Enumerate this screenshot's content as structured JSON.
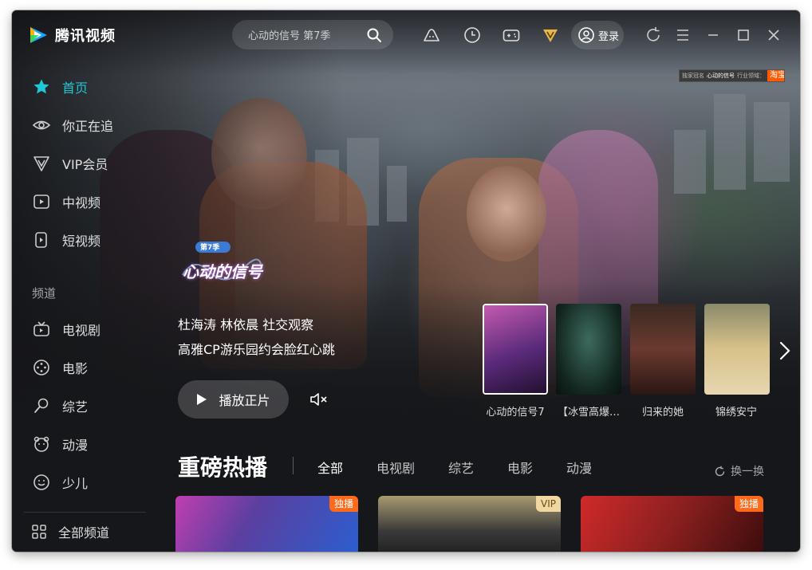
{
  "app": {
    "name": "腾讯视频",
    "colors": {
      "accent": "#1ec8d6",
      "vip_gold": "#e8b84a",
      "badge_orange": "#ff6a1a"
    }
  },
  "search": {
    "placeholder": "心动的信号 第7季",
    "icon": "search-icon"
  },
  "toolbar": {
    "icons": [
      "cloud-game-icon",
      "history-icon",
      "gamepad-icon",
      "vip-diamond-icon"
    ],
    "login_label": "登录",
    "window_controls": [
      "refresh-icon",
      "menu-icon",
      "minimize-icon",
      "maximize-icon",
      "close-icon"
    ]
  },
  "ad": {
    "left_text": "独家冠名",
    "brand": "心动的信号",
    "mid_text": "行业领域：",
    "right_text": "淘宝"
  },
  "sidebar": {
    "primary": [
      {
        "label": "首页",
        "icon": "star-icon",
        "active": true
      },
      {
        "label": "你正在追",
        "icon": "eye-icon"
      },
      {
        "label": "VIP会员",
        "icon": "vip-icon"
      },
      {
        "label": "中视频",
        "icon": "video-icon"
      },
      {
        "label": "短视频",
        "icon": "short-video-icon"
      }
    ],
    "channel_title": "频道",
    "channels": [
      {
        "label": "电视剧",
        "icon": "tv-icon"
      },
      {
        "label": "电影",
        "icon": "film-reel-icon"
      },
      {
        "label": "综艺",
        "icon": "microphone-icon"
      },
      {
        "label": "动漫",
        "icon": "bear-icon"
      },
      {
        "label": "少儿",
        "icon": "kids-icon"
      }
    ],
    "all_channels": {
      "label": "全部频道",
      "icon": "grid-icon"
    }
  },
  "hero": {
    "show_logo_text": "心动的信号",
    "show_logo_sub": "第7季",
    "line1": "杜海涛 林依晨 社交观察",
    "line2": "高雅CP游乐园约会脸红心跳",
    "play_label": "播放正片",
    "thumbnails": [
      {
        "label": "心动的信号7",
        "selected": true,
        "color": "#7a3a8a"
      },
      {
        "label": "【冰雪高爆…",
        "color": "#1c3a33"
      },
      {
        "label": "归来的她",
        "color": "#4a2a2a"
      },
      {
        "label": "锦绣安宁",
        "color": "#c9b27a"
      }
    ]
  },
  "section": {
    "title": "重磅热播",
    "tabs": [
      "全部",
      "电视剧",
      "综艺",
      "电影",
      "动漫"
    ],
    "refresh_label": "换一换",
    "cards": [
      {
        "badge": "独播",
        "badge_type": "exclusive",
        "color": "#5b3fa0"
      },
      {
        "badge": "VIP",
        "badge_type": "vip",
        "color": "#6d5a3a"
      },
      {
        "badge": "独播",
        "badge_type": "exclusive",
        "color": "#8a1f1f"
      }
    ]
  }
}
